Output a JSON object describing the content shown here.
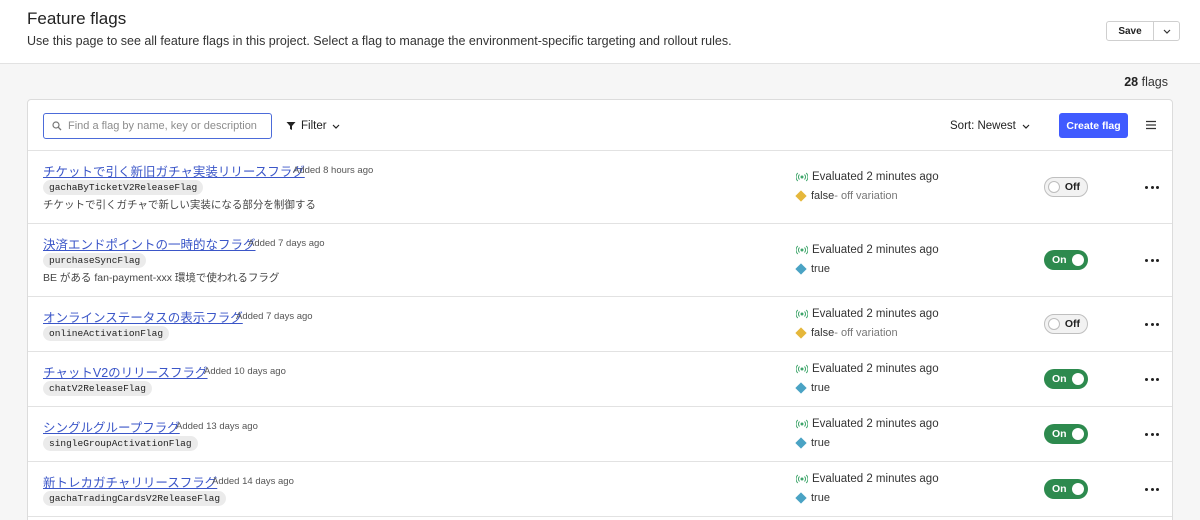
{
  "header": {
    "title": "Feature flags",
    "description": "Use this page to see all feature flags in this project. Select a flag to manage the environment-specific targeting and rollout rules.",
    "save_label": "Save"
  },
  "count": {
    "number": "28",
    "label": "flags"
  },
  "toolbar": {
    "search_placeholder": "Find a flag by name, key or description",
    "filter_label": "Filter",
    "sort_label": "Sort: Newest",
    "create_label": "Create flag"
  },
  "colors": {
    "accent": "#405bff",
    "link": "#3b56c8",
    "on": "#2d8a4e",
    "false_variation": "#e5b73b",
    "true_variation": "#4aa3c4",
    "eval_icon": "#3fa66b"
  },
  "flags": [
    {
      "name": "チケットで引く新旧ガチャ実装リリースフラグ",
      "added": "Added 8 hours ago",
      "key": "gachaByTicketV2ReleaseFlag",
      "description": "チケットで引くガチャで新しい実装になる部分を制御する",
      "evaluated": "Evaluated 2 minutes ago",
      "variation": "false",
      "variation_suffix": " - off variation",
      "state": "Off"
    },
    {
      "name": "決済エンドポイントの一時的なフラグ",
      "added": "Added 7 days ago",
      "key": "purchaseSyncFlag",
      "description": "BE がある fan-payment-xxx 環境で使われるフラグ",
      "evaluated": "Evaluated 2 minutes ago",
      "variation": "true",
      "variation_suffix": "",
      "state": "On"
    },
    {
      "name": "オンラインステータスの表示フラグ",
      "added": "Added 7 days ago",
      "key": "onlineActivationFlag",
      "description": "",
      "evaluated": "Evaluated 2 minutes ago",
      "variation": "false",
      "variation_suffix": " - off variation",
      "state": "Off"
    },
    {
      "name": "チャットV2のリリースフラグ",
      "added": "Added 10 days ago",
      "key": "chatV2ReleaseFlag",
      "description": "",
      "evaluated": "Evaluated 2 minutes ago",
      "variation": "true",
      "variation_suffix": "",
      "state": "On"
    },
    {
      "name": "シングルグループフラグ",
      "added": "Added 13 days ago",
      "key": "singleGroupActivationFlag",
      "description": "",
      "evaluated": "Evaluated 2 minutes ago",
      "variation": "true",
      "variation_suffix": "",
      "state": "On"
    },
    {
      "name": "新トレカガチャリリースフラグ",
      "added": "Added 14 days ago",
      "key": "gachaTradingCardsV2ReleaseFlag",
      "description": "",
      "evaluated": "Evaluated 2 minutes ago",
      "variation": "true",
      "variation_suffix": "",
      "state": "On"
    }
  ]
}
